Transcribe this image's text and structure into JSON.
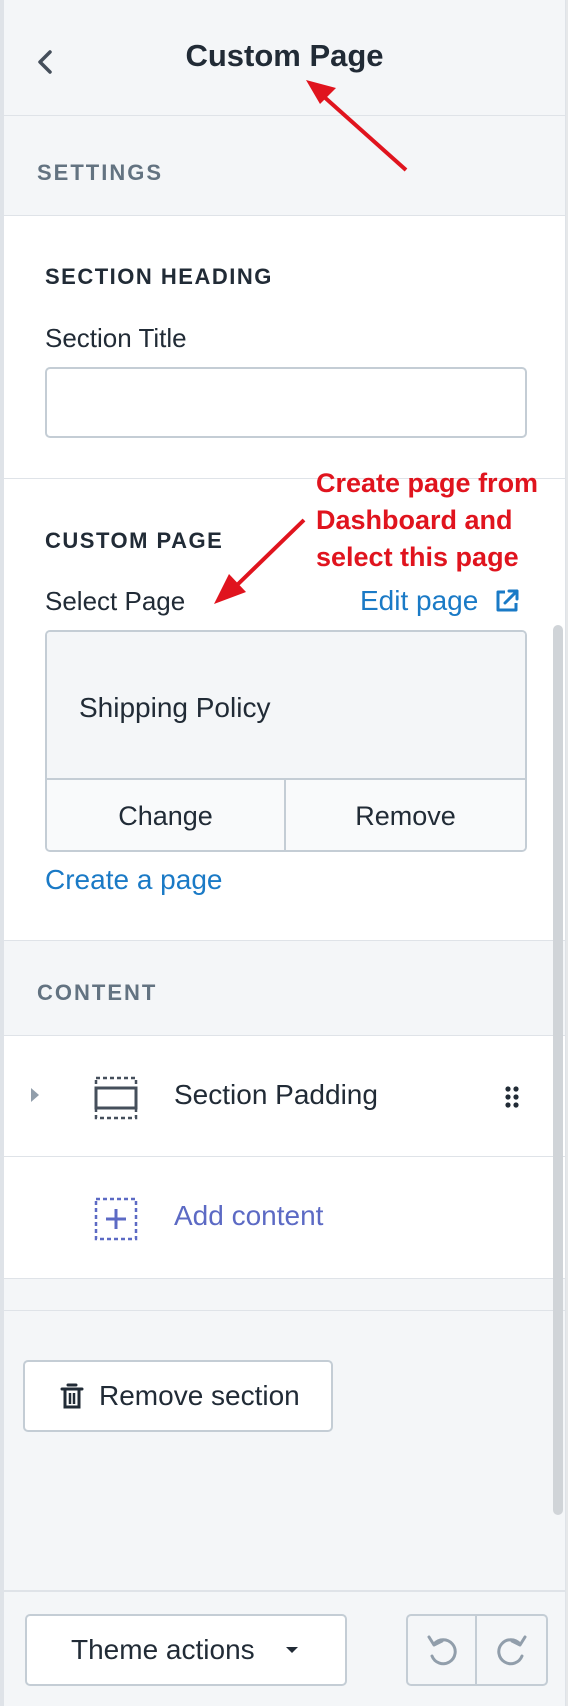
{
  "header": {
    "title": "Custom Page"
  },
  "settings_band": {
    "title": "SETTINGS"
  },
  "section_heading": {
    "heading": "SECTION HEADING",
    "field_label": "Section Title",
    "field_value": "",
    "placeholder": ""
  },
  "custom_page": {
    "heading": "CUSTOM PAGE",
    "select_label": "Select Page",
    "edit_link": "Edit page",
    "selected_page": "Shipping Policy",
    "change_label": "Change",
    "remove_label": "Remove",
    "create_link": "Create a page"
  },
  "content_band": {
    "title": "CONTENT"
  },
  "content_items": [
    {
      "label": "Section Padding",
      "icon": "section-padding-icon"
    },
    {
      "label": "Add content",
      "icon": "add-content-icon"
    }
  ],
  "remove_section": {
    "label": "Remove section",
    "icon": "trash-icon"
  },
  "footer": {
    "theme_actions": "Theme actions",
    "undo_icon": "undo-icon",
    "redo_icon": "redo-icon"
  },
  "annotations": {
    "note": [
      "Create page from",
      "Dashboard and",
      "select this page"
    ],
    "color": "#e0141e"
  },
  "colors": {
    "link": "#1a7ac6",
    "accent": "#5c6ac4",
    "annotation": "#e0141e"
  }
}
